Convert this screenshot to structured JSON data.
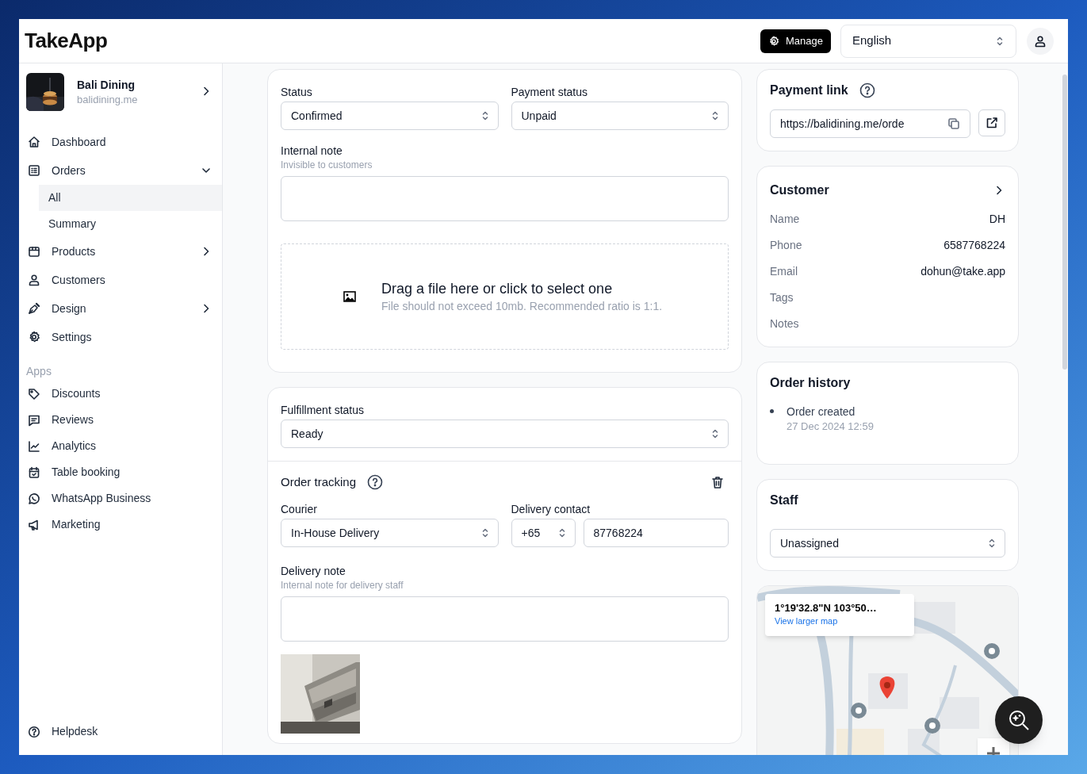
{
  "header": {
    "logo": "TakeApp",
    "manage_button": "Manage",
    "language": "English"
  },
  "store": {
    "name": "Bali Dining",
    "domain": "balidining.me"
  },
  "sidebar": {
    "items": [
      {
        "label": "Dashboard",
        "kind": "home",
        "selected": false,
        "expandable": false
      },
      {
        "label": "Orders",
        "kind": "orders",
        "selected": false,
        "expandable": true,
        "expanded": true,
        "children": [
          {
            "label": "All",
            "selected": true
          },
          {
            "label": "Summary",
            "selected": false
          }
        ]
      },
      {
        "label": "Products",
        "kind": "box",
        "selected": false,
        "expandable": true,
        "expanded": false
      },
      {
        "label": "Customers",
        "kind": "user",
        "selected": false,
        "expandable": false
      },
      {
        "label": "Design",
        "kind": "pen",
        "selected": false,
        "expandable": true,
        "expanded": false
      },
      {
        "label": "Settings",
        "kind": "gear",
        "selected": false,
        "expandable": false
      }
    ],
    "apps_heading": "Apps",
    "apps": [
      {
        "label": "Discounts",
        "kind": "tag",
        "selected": false
      },
      {
        "label": "Reviews",
        "kind": "review",
        "selected": false
      },
      {
        "label": "Analytics",
        "kind": "chart",
        "selected": false
      },
      {
        "label": "Table booking",
        "kind": "calendar",
        "selected": false
      },
      {
        "label": "WhatsApp Business",
        "kind": "chat",
        "selected": false
      },
      {
        "label": "Marketing",
        "kind": "megaphone",
        "selected": false
      }
    ],
    "footer": {
      "label": "Helpdesk",
      "kind": "help",
      "selected": false
    }
  },
  "order_form": {
    "status": {
      "label": "Status",
      "value": "Confirmed"
    },
    "payment_status": {
      "label": "Payment status",
      "value": "Unpaid"
    },
    "internal_note": {
      "label": "Internal note",
      "hint": "Invisible to customers"
    },
    "upload": {
      "title": "Drag a file here or click to select one",
      "hint": "File should not exceed 10mb. Recommended ratio is 1:1."
    }
  },
  "fulfillment": {
    "label": "Fulfillment status",
    "value": "Ready"
  },
  "tracking": {
    "title": "Order tracking",
    "courier": {
      "label": "Courier",
      "value": "In-House Delivery"
    },
    "delivery_contact": {
      "label": "Delivery contact",
      "country_code": "+65",
      "phone": "87768224"
    },
    "delivery_note": {
      "label": "Delivery note",
      "hint": "Internal note for delivery staff"
    }
  },
  "payment_link": {
    "title": "Payment link",
    "url": "https://balidining.me/orde"
  },
  "customer": {
    "title": "Customer",
    "fields": [
      {
        "label": "Name",
        "value": "DH"
      },
      {
        "label": "Phone",
        "value": "6587768224"
      },
      {
        "label": "Email",
        "value": "dohun@take.app"
      },
      {
        "label": "Tags"
      },
      {
        "label": "Notes"
      }
    ]
  },
  "order_history": {
    "title": "Order history",
    "events": [
      {
        "title": "Order created",
        "time": "27 Dec 2024 12:59"
      }
    ]
  },
  "staff": {
    "title": "Staff",
    "value": "Unassigned"
  },
  "map": {
    "coordinates": "1°19'32.8\"N 103°50…",
    "link": "View larger map"
  }
}
